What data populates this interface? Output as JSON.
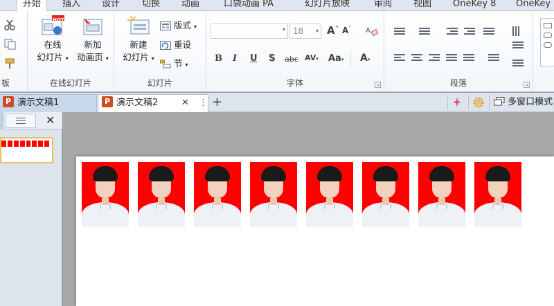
{
  "ribbon_tabs": [
    {
      "label": "开始",
      "active": true
    },
    {
      "label": "插入"
    },
    {
      "label": "设计"
    },
    {
      "label": "切换"
    },
    {
      "label": "动画"
    },
    {
      "label": "口袋动画 PA"
    },
    {
      "label": "幻灯片放映"
    },
    {
      "label": "审阅"
    },
    {
      "label": "视图"
    },
    {
      "label": "OneKey 8"
    },
    {
      "label": "OneKey"
    }
  ],
  "clipboard": {
    "label": "板"
  },
  "online_slides": {
    "group_label": "在线幻灯片",
    "online_slide_line1": "在线",
    "online_slide_line2": "幻灯片",
    "new_anim_line1": "新加",
    "new_anim_line2": "动画页",
    "hot_badge": "HOT"
  },
  "slides": {
    "group_label": "幻灯片",
    "new_slide_line1": "新建",
    "new_slide_line2": "幻灯片",
    "layout": "版式",
    "reset": "重设",
    "section": "节"
  },
  "font": {
    "group_label": "字体",
    "font_name": "",
    "font_size": "18",
    "bold": "B",
    "italic": "I",
    "underline": "U",
    "shadow": "S",
    "strike": "abc",
    "spacing": "AV",
    "case": "Aa",
    "color": "A",
    "grow": "A",
    "shrink": "A"
  },
  "paragraph": {
    "group_label": "段落"
  },
  "documents": {
    "tab1": "演示文稿1",
    "tab2": "演示文稿2",
    "ppt_glyph": "P",
    "close": "✕",
    "more": "⋮",
    "add": "+",
    "multi_window": "多窗口模式"
  },
  "slide": {
    "photo_count": 8,
    "photo_background": "#ff0000"
  },
  "colors": {
    "accent_orange": "#d04a23",
    "selection_gold": "#e9c05a"
  }
}
